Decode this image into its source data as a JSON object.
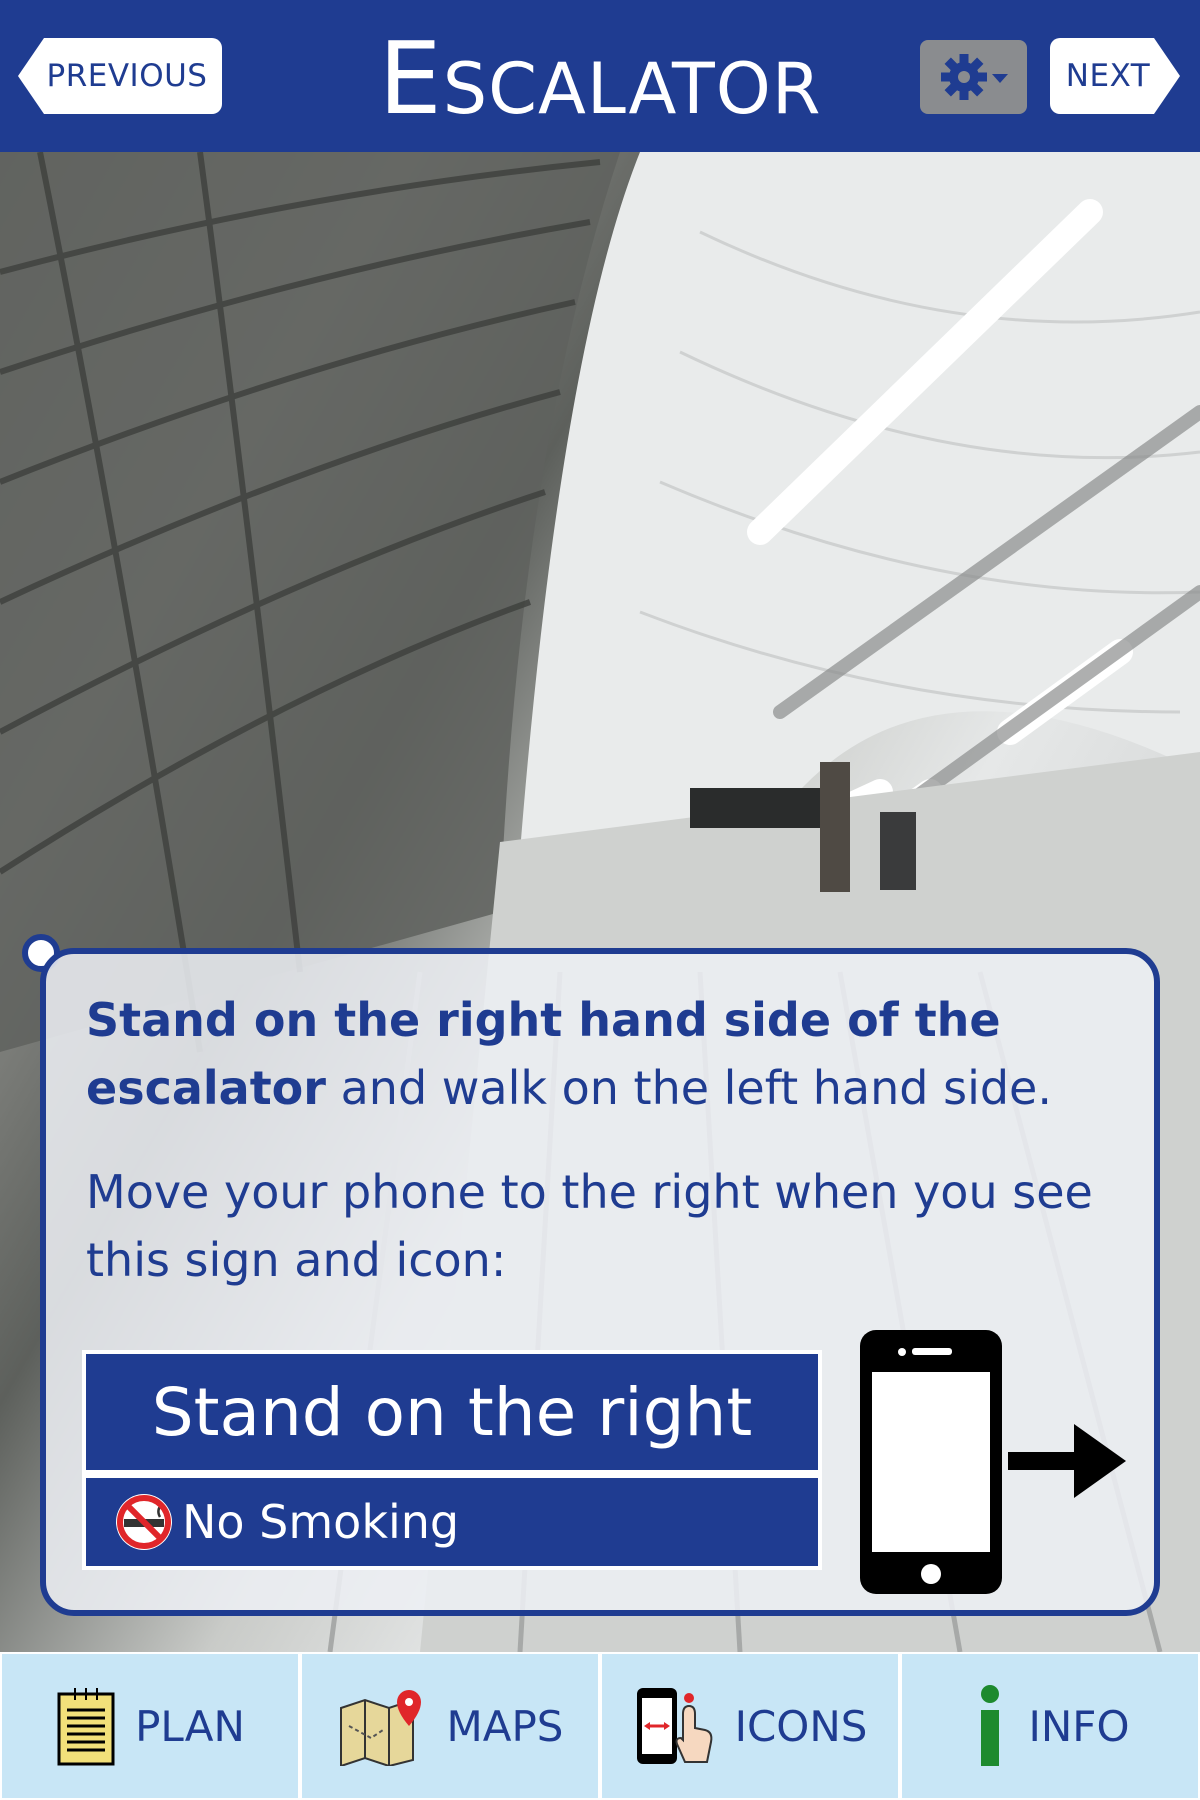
{
  "header": {
    "title": "Escalator",
    "previous_label": "PREVIOUS",
    "next_label": "NEXT",
    "settings_icon": "gear-dropdown-icon"
  },
  "instruction": {
    "bold_text": "Stand on the right hand side of the escalator",
    "rest_text": " and walk on the left hand side.",
    "second_paragraph": "Move your phone to the right when you see this sign and icon:"
  },
  "sign": {
    "main_text": "Stand on the right",
    "secondary_text": "No Smoking"
  },
  "tabs": [
    {
      "label": "PLAN",
      "icon": "notepad-icon"
    },
    {
      "label": "MAPS",
      "icon": "map-icon"
    },
    {
      "label": "ICONS",
      "icon": "phone-gesture-icon"
    },
    {
      "label": "INFO",
      "icon": "info-icon"
    }
  ],
  "colors": {
    "primary": "#1f3c91",
    "tab_background": "#c8e6f6",
    "settings_button": "#8a8c8f"
  }
}
